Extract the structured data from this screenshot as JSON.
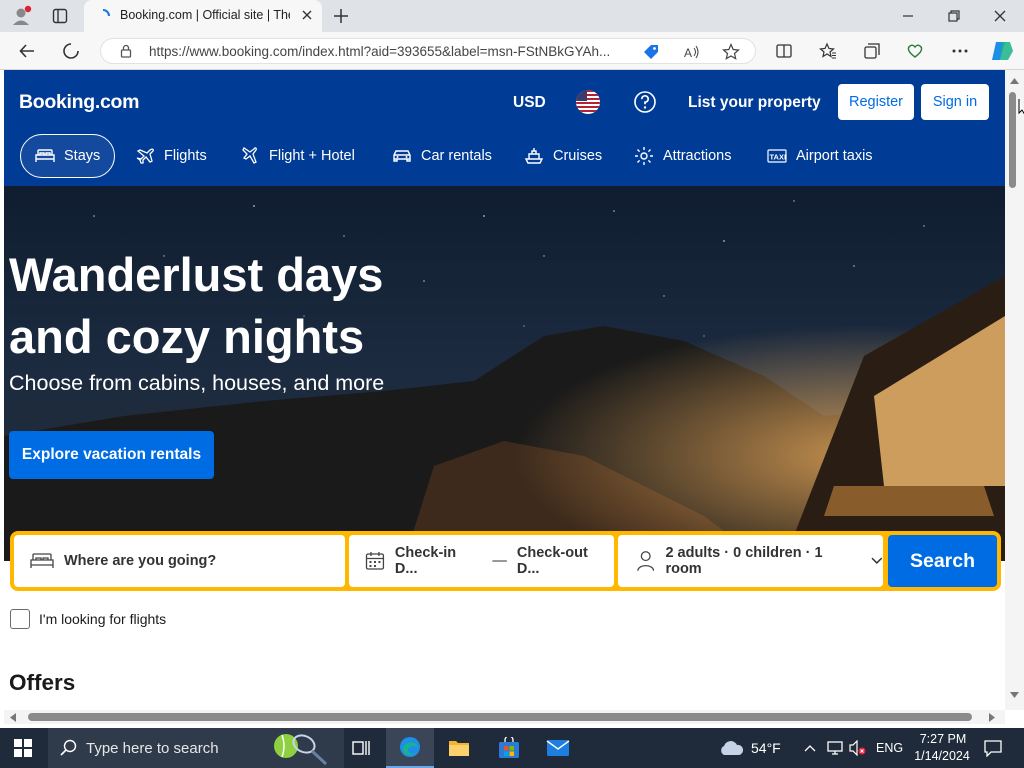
{
  "browser": {
    "tab_title": "Booking.com | Official site | The b",
    "url": "https://www.booking.com/index.html?aid=393655&label=msn-FStNBkGYAh..."
  },
  "header": {
    "logo": "Booking.com",
    "currency": "USD",
    "list_property": "List your property",
    "register": "Register",
    "sign_in": "Sign in"
  },
  "nav": {
    "items": [
      {
        "label": "Stays",
        "icon": "bed-icon",
        "active": true
      },
      {
        "label": "Flights",
        "icon": "plane-icon"
      },
      {
        "label": "Flight + Hotel",
        "icon": "flight-hotel-icon"
      },
      {
        "label": "Car rentals",
        "icon": "car-icon"
      },
      {
        "label": "Cruises",
        "icon": "ship-icon"
      },
      {
        "label": "Attractions",
        "icon": "attractions-icon"
      },
      {
        "label": "Airport taxis",
        "icon": "taxi-icon"
      }
    ]
  },
  "hero": {
    "title_line1": "Wanderlust days",
    "title_line2": "and cozy nights",
    "subtitle": "Choose from cabins, houses, and more",
    "cta": "Explore vacation rentals"
  },
  "search": {
    "destination_placeholder": "Where are you going?",
    "checkin": "Check-in D...",
    "dash": "—",
    "checkout": "Check-out D...",
    "occupancy": "2 adults · 0 children · 1 room",
    "search_button": "Search",
    "flights_checkbox": "I'm looking for flights"
  },
  "sections": {
    "offers": "Offers"
  },
  "taskbar": {
    "search_placeholder": "Type here to search",
    "temperature": "54°F",
    "language": "ENG",
    "time": "7:27 PM",
    "date": "1/14/2024"
  },
  "colors": {
    "brand_blue": "#003b95",
    "action_blue": "#006ce4",
    "search_border": "#ffb700"
  }
}
